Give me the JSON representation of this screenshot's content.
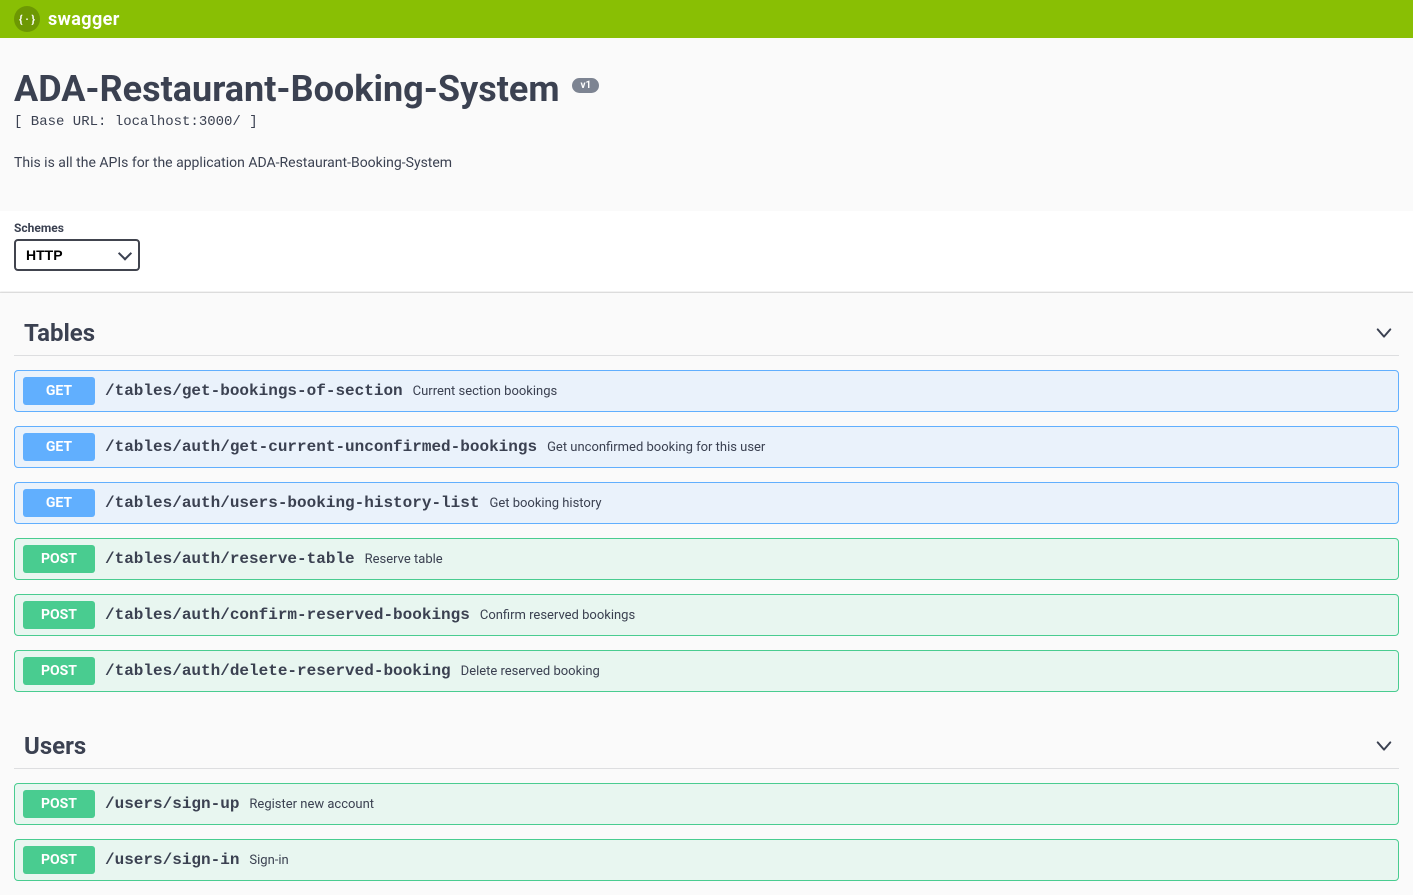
{
  "topbar": {
    "logo_text": "swagger",
    "logo_glyph": "{ · }"
  },
  "info": {
    "title": "ADA-Restaurant-Booking-System",
    "version": "v1",
    "base_url": "[ Base URL: localhost:3000/ ]",
    "description": "This is all the APIs for the application ADA-Restaurant-Booking-System"
  },
  "schemes": {
    "label": "Schemes",
    "selected": "HTTP"
  },
  "tags": [
    {
      "name": "Tables",
      "ops": [
        {
          "method": "GET",
          "path": "/tables/get-bookings-of-section",
          "summary": "Current section bookings"
        },
        {
          "method": "GET",
          "path": "/tables/auth/get-current-unconfirmed-bookings",
          "summary": "Get unconfirmed booking for this user"
        },
        {
          "method": "GET",
          "path": "/tables/auth/users-booking-history-list",
          "summary": "Get booking history"
        },
        {
          "method": "POST",
          "path": "/tables/auth/reserve-table",
          "summary": "Reserve table"
        },
        {
          "method": "POST",
          "path": "/tables/auth/confirm-reserved-bookings",
          "summary": "Confirm reserved bookings"
        },
        {
          "method": "POST",
          "path": "/tables/auth/delete-reserved-booking",
          "summary": "Delete reserved booking"
        }
      ]
    },
    {
      "name": "Users",
      "ops": [
        {
          "method": "POST",
          "path": "/users/sign-up",
          "summary": "Register new account"
        },
        {
          "method": "POST",
          "path": "/users/sign-in",
          "summary": "Sign-in"
        }
      ]
    }
  ]
}
